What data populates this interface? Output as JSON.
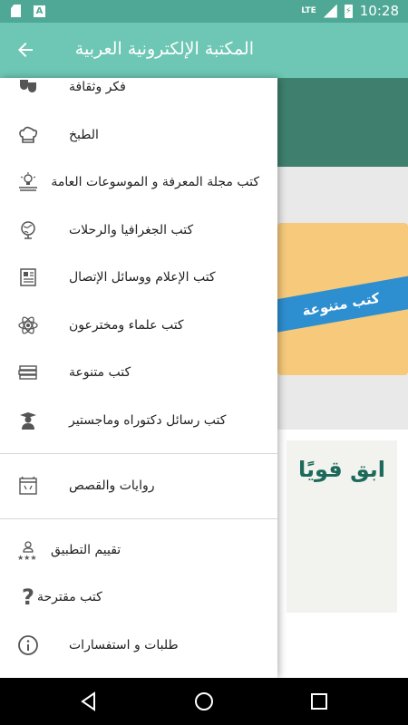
{
  "status_bar": {
    "network": "LTE",
    "time": "10:28",
    "a_badge": "A"
  },
  "app_bar": {
    "title": "المكتبة الإلكترونية العربية",
    "back_icon": "arrow-left-icon",
    "color": "#6dc7b4"
  },
  "background": {
    "ribbon_text": "كتب متنوعة",
    "cover_title": "ابق قويًا"
  },
  "drawer": {
    "items": [
      {
        "label": "فكر وثقافة",
        "icon": "theater-masks-icon"
      },
      {
        "label": "الطبخ",
        "icon": "chef-hat-icon"
      },
      {
        "label": "كتب مجلة المعرفة و الموسوعات العامة",
        "icon": "lightbulb-book-icon"
      },
      {
        "label": "كتب الجغرافيا والرحلات",
        "icon": "globe-icon"
      },
      {
        "label": "كتب الإعلام ووسائل الإتصال",
        "icon": "newspaper-icon"
      },
      {
        "label": "كتب علماء ومخترعون",
        "icon": "atom-icon"
      },
      {
        "label": "كتب متنوعة",
        "icon": "book-stack-icon"
      },
      {
        "label": "كتب رسائل دكتوراه وماجستير",
        "icon": "graduate-icon"
      },
      {
        "label": "روايات والقصص",
        "icon": "theater-stage-icon"
      },
      {
        "label": "تقييم التطبيق",
        "icon": "rating-stars-icon"
      },
      {
        "label": "كتب مقترحة",
        "icon": "question-mark-icon"
      },
      {
        "label": "طلبات و استفسارات",
        "icon": "info-icon"
      }
    ]
  }
}
